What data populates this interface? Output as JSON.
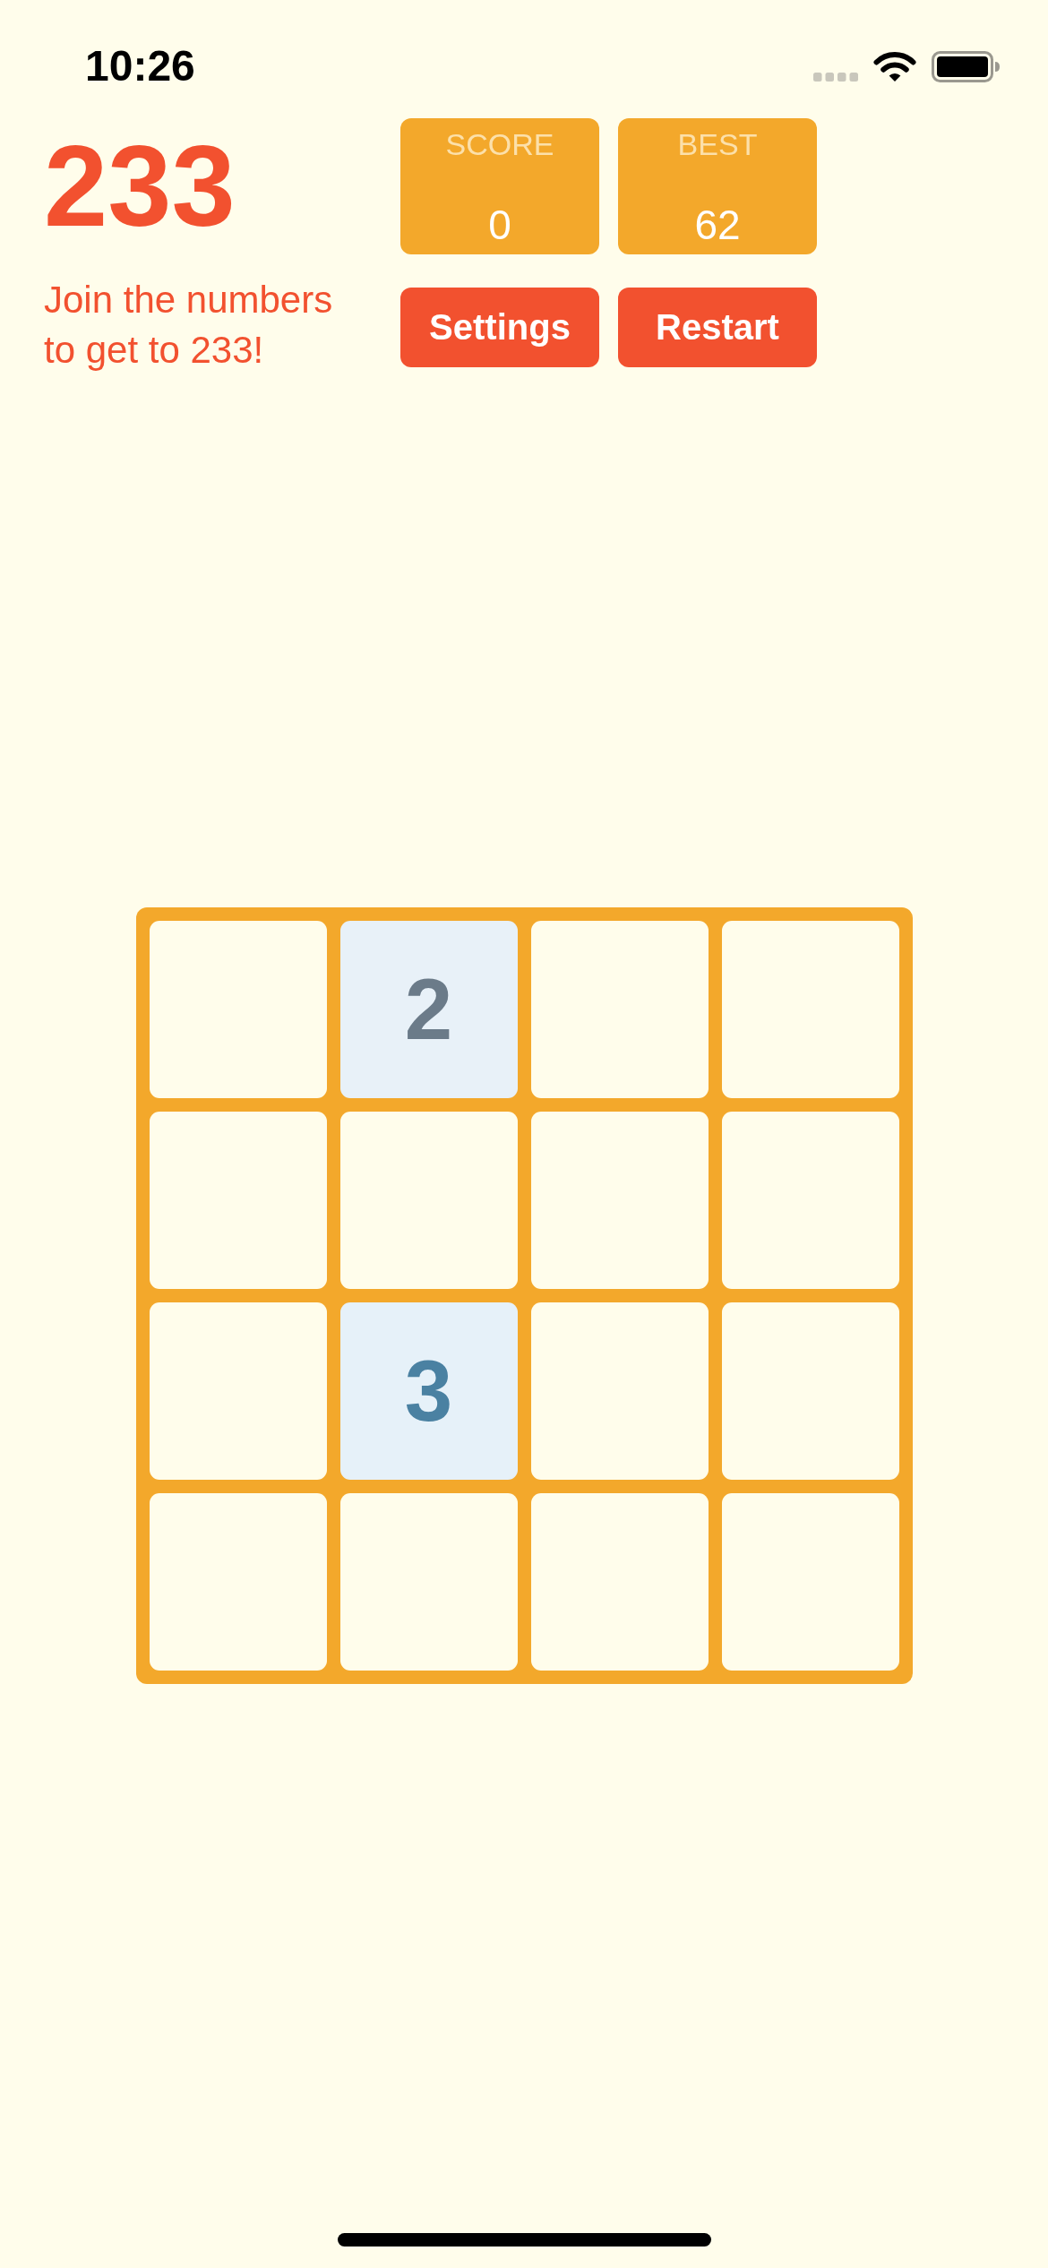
{
  "status_bar": {
    "time": "10:26"
  },
  "header": {
    "title": "233",
    "subtitle": "Join the numbers to get to 233!"
  },
  "scores": [
    {
      "label": "SCORE",
      "value": "0"
    },
    {
      "label": "BEST",
      "value": "62"
    }
  ],
  "buttons": [
    {
      "label": "Settings"
    },
    {
      "label": "Restart"
    }
  ],
  "board": {
    "rows": [
      {
        "cells": [
          {
            "kind": "empty"
          },
          {
            "kind": "tile",
            "value": "2",
            "color": "#6b7b89"
          },
          {
            "kind": "empty"
          },
          {
            "kind": "empty"
          }
        ]
      },
      {
        "cells": [
          {
            "kind": "empty"
          },
          {
            "kind": "empty"
          },
          {
            "kind": "empty"
          },
          {
            "kind": "empty"
          }
        ]
      },
      {
        "cells": [
          {
            "kind": "empty"
          },
          {
            "kind": "tile",
            "value": "3",
            "color": "#4a81a2"
          },
          {
            "kind": "empty"
          },
          {
            "kind": "empty"
          }
        ]
      },
      {
        "cells": [
          {
            "kind": "empty"
          },
          {
            "kind": "empty"
          },
          {
            "kind": "empty"
          },
          {
            "kind": "empty"
          }
        ]
      }
    ]
  }
}
